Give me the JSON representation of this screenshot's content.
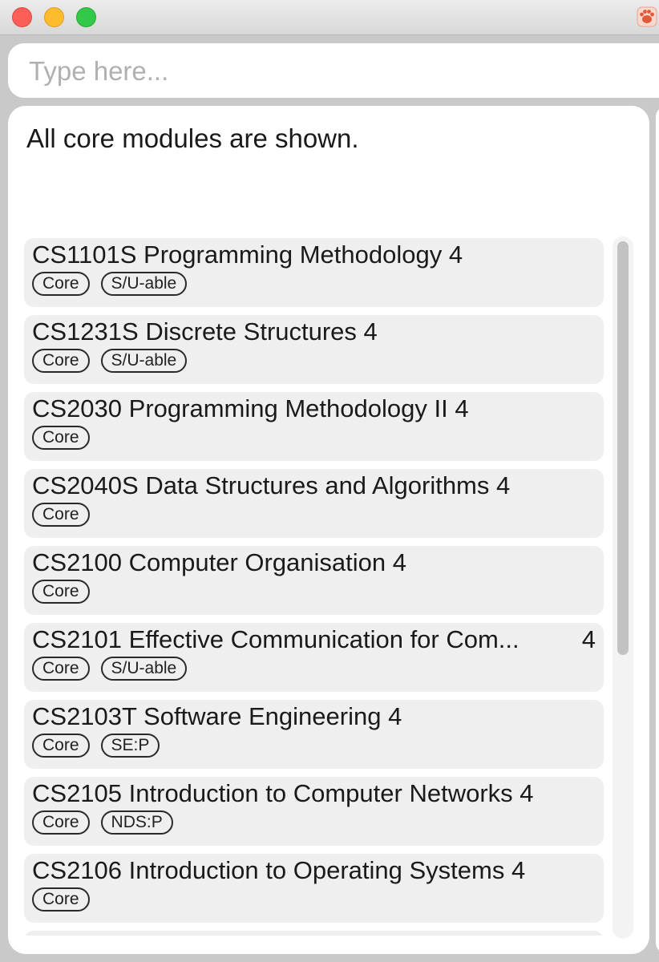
{
  "search": {
    "placeholder": "Type here...",
    "value": ""
  },
  "status": {
    "message": "All core modules are shown."
  },
  "modules": [
    {
      "code": "CS1101S",
      "title": "Programming Methodology",
      "credits": "4",
      "tags": [
        "Core",
        "S/U-able"
      ]
    },
    {
      "code": "CS1231S",
      "title": "Discrete Structures",
      "credits": "4",
      "tags": [
        "Core",
        "S/U-able"
      ]
    },
    {
      "code": "CS2030",
      "title": "Programming Methodology II",
      "credits": "4",
      "tags": [
        "Core"
      ]
    },
    {
      "code": "CS2040S",
      "title": "Data Structures and Algorithms",
      "credits": "4",
      "tags": [
        "Core"
      ]
    },
    {
      "code": "CS2100",
      "title": "Computer Organisation",
      "credits": "4",
      "tags": [
        "Core"
      ]
    },
    {
      "code": "CS2101",
      "title": "Effective Communication for Com...",
      "credits": "4",
      "tags": [
        "Core",
        "S/U-able"
      ]
    },
    {
      "code": "CS2103T",
      "title": "Software Engineering",
      "credits": "4",
      "tags": [
        "Core",
        "SE:P"
      ]
    },
    {
      "code": "CS2105",
      "title": "Introduction to Computer Networks",
      "credits": "4",
      "tags": [
        "Core",
        "NDS:P"
      ]
    },
    {
      "code": "CS2106",
      "title": "Introduction to Operating Systems",
      "credits": "4",
      "tags": [
        "Core"
      ]
    }
  ],
  "colors": {
    "window_bg": "#c9c9c9",
    "card_bg": "#efefef",
    "close": "#fc5f57",
    "minimize": "#fdbc2e",
    "maximize": "#34c84a"
  },
  "icons": {
    "app": "paw-icon"
  }
}
